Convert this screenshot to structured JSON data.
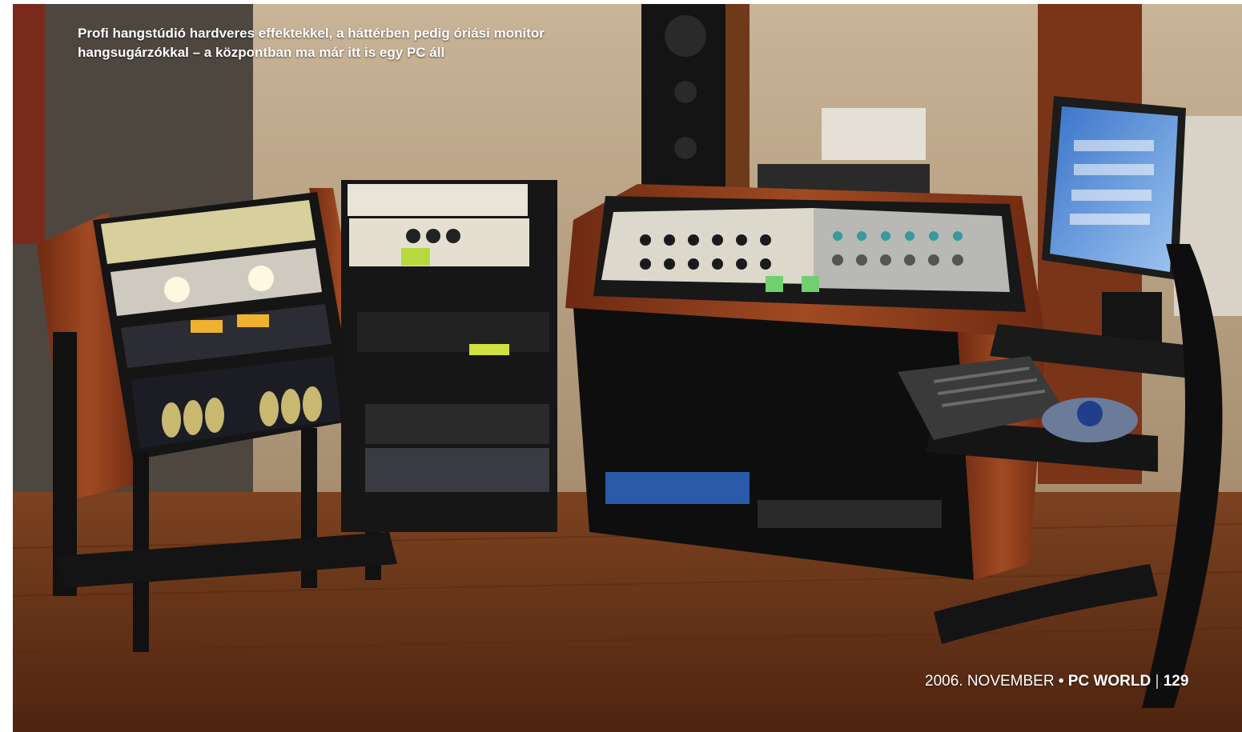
{
  "caption": {
    "line1": "Profi hangstúdió hardveres effektekkel, a háttérben pedig óriási monitor",
    "line2": "hangsugárzókkal – a központban ma már itt is egy PC áll"
  },
  "folio": {
    "date": "2006. NOVEMBER",
    "bullet": "•",
    "magazine": "PC WORLD",
    "separator": "|",
    "page": "129"
  },
  "photo": {
    "description_objects": [
      "studio-wall",
      "floor",
      "left-rack",
      "middle-rack",
      "mixing-console",
      "monitor-speaker",
      "lcd-monitor",
      "keyboard",
      "trackball",
      "computer-stand"
    ]
  },
  "colors": {
    "wall": "#bfa688",
    "floor": "#6e3a1a",
    "wood": "#8a3a1c",
    "rack": "#1a1a1a",
    "console_panel": "#d8d4c8",
    "screen": "#4a86d6"
  }
}
